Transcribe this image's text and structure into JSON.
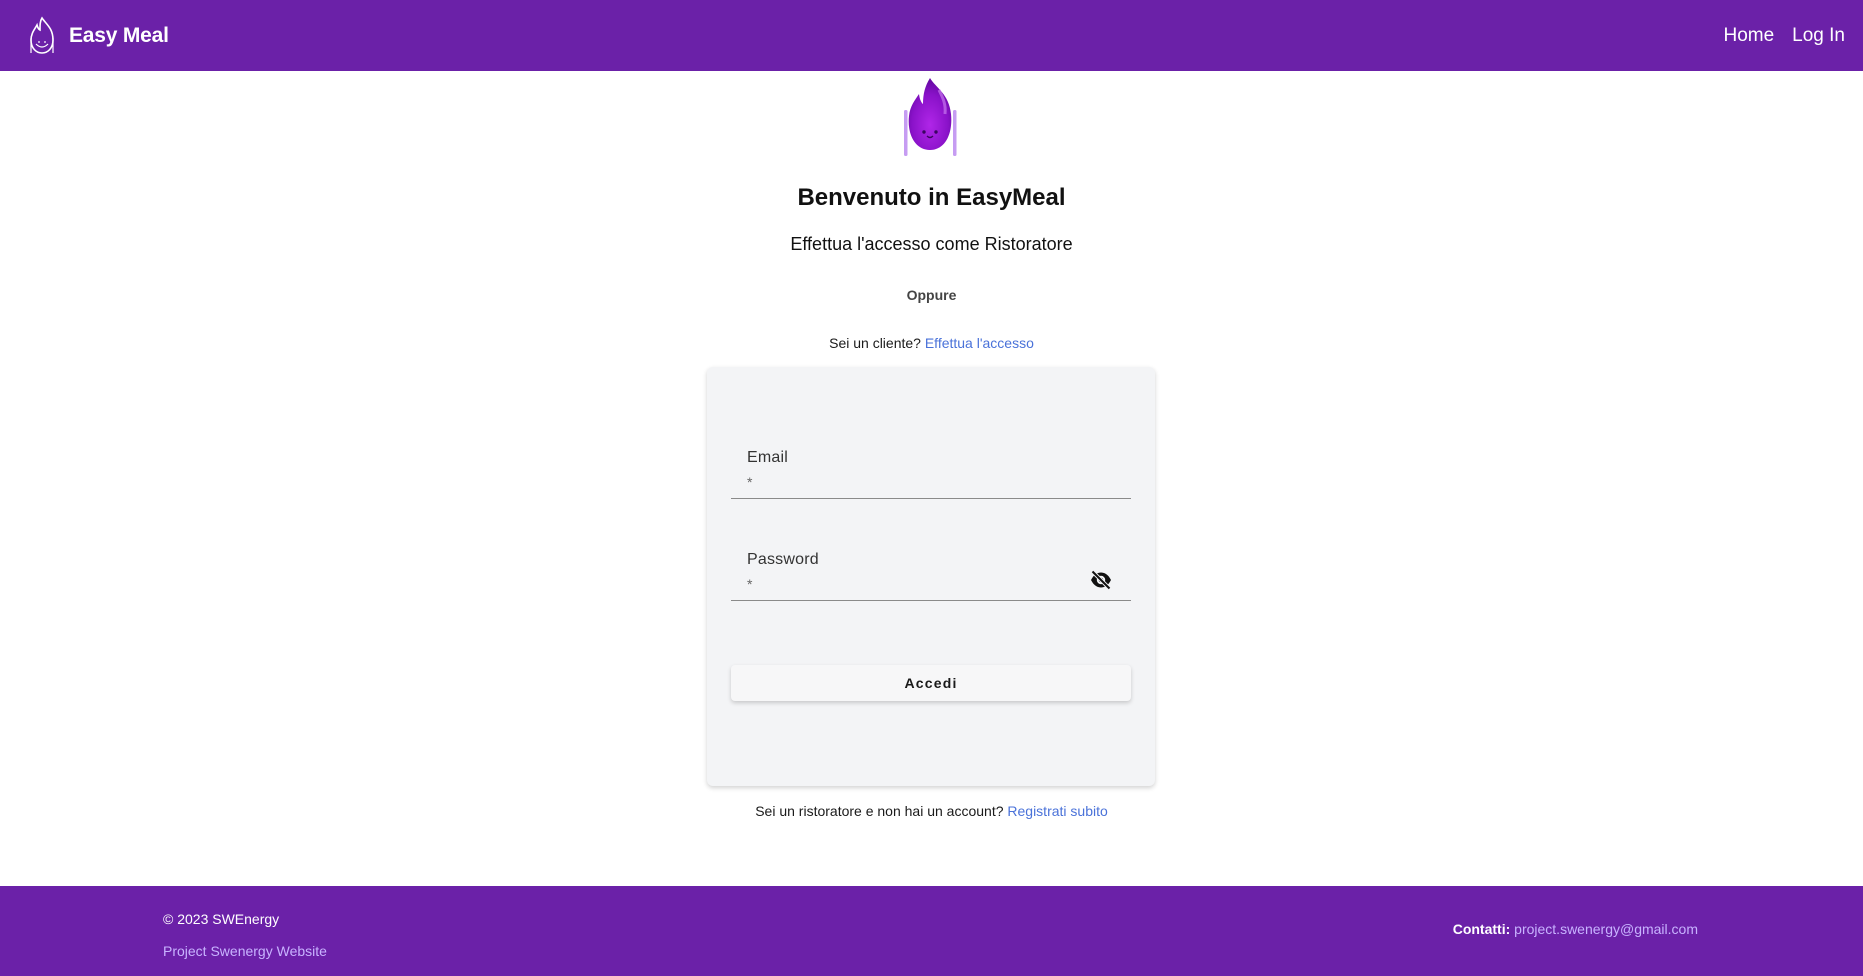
{
  "header": {
    "brand_name": "Easy Meal",
    "nav": {
      "home": "Home",
      "login": "Log In"
    }
  },
  "main": {
    "title": "Benvenuto in EasyMeal",
    "subtitle": "Effettua l'accesso come Ristoratore",
    "oppure": "Oppure",
    "client_prefix": "Sei un cliente?",
    "client_link": "Effettua l'accesso",
    "form": {
      "email_label": "Email",
      "email_required": "*",
      "email_value": "",
      "password_label": "Password",
      "password_required": "*",
      "password_value": "",
      "submit_label": "Accedi"
    },
    "register_prefix": "Sei un ristoratore e non hai un account?",
    "register_link": "Registrati subito"
  },
  "footer": {
    "copyright": "© 2023 SWEnergy",
    "project_link": "Project Swenergy Website",
    "contacts_label": "Contatti:",
    "contact_email": "project.swenergy@gmail.com"
  },
  "icons": {
    "logo": "flame-mascot-icon",
    "password_toggle": "eye-off-icon"
  },
  "colors": {
    "brand_purple": "#6b21a8",
    "link_blue": "#4a72d9",
    "footer_link": "#c8b3ff",
    "card_bg": "#f3f4f6"
  }
}
